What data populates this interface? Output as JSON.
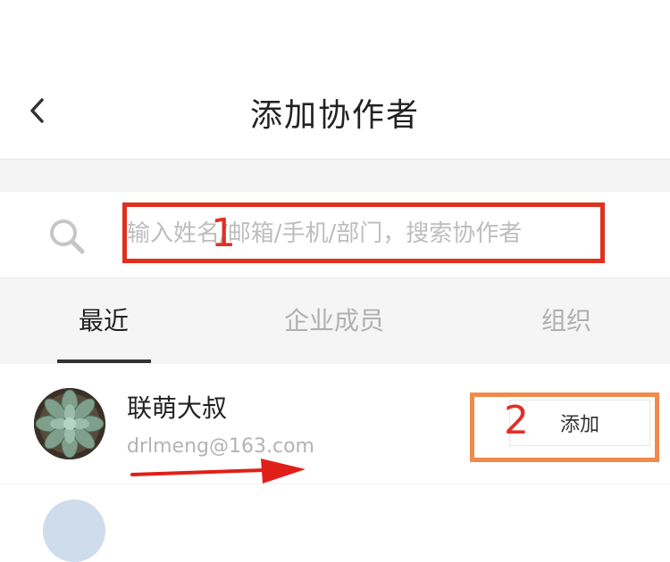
{
  "header": {
    "title": "添加协作者"
  },
  "search": {
    "placeholder": "输入姓名/邮箱/手机/部门，搜索协作者"
  },
  "annotations": {
    "step1": "1",
    "step2": "2"
  },
  "tabs": [
    {
      "label": "最近",
      "active": true
    },
    {
      "label": "企业成员",
      "active": false
    },
    {
      "label": "组织",
      "active": false
    }
  ],
  "contacts": [
    {
      "name": "联萌大叔",
      "email": "drlmeng@163.com",
      "action_label": "添加"
    }
  ],
  "colors": {
    "annotation_red": "#e0301e",
    "annotation_orange": "#f08a4b",
    "arrow_red": "#e02018",
    "tab_active": "#222222",
    "tab_inactive": "#b0b0b0"
  }
}
